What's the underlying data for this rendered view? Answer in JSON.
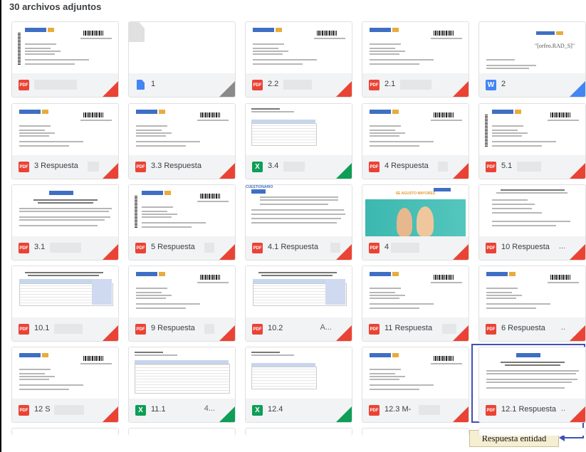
{
  "header": {
    "title": "30 archivos adjuntos"
  },
  "attachments": [
    {
      "name": "",
      "type": "pdf",
      "thumb": "letter-vertical"
    },
    {
      "name": "1",
      "type": "generic",
      "thumb": "empty"
    },
    {
      "name": "2.2",
      "type": "pdf",
      "thumb": "letter"
    },
    {
      "name": "2.1",
      "type": "pdf",
      "thumb": "letter"
    },
    {
      "name": "2",
      "type": "word",
      "thumb": "orfeo"
    },
    {
      "name": "3 Respuesta",
      "type": "pdf",
      "thumb": "letter"
    },
    {
      "name": "3.3 Respuesta",
      "type": "pdf",
      "thumb": "letter"
    },
    {
      "name": "3.4",
      "type": "excel",
      "thumb": "sheet"
    },
    {
      "name": "4 Respuesta",
      "type": "pdf",
      "thumb": "letter"
    },
    {
      "name": "5.1",
      "type": "pdf",
      "thumb": "letter-vertical"
    },
    {
      "name": "3.1",
      "type": "pdf",
      "thumb": "doc-center"
    },
    {
      "name": "5 Respuesta",
      "type": "pdf",
      "thumb": "letter-vertical"
    },
    {
      "name": "4.1 Respuesta",
      "type": "pdf",
      "thumb": "questionnaire"
    },
    {
      "name": "4",
      "type": "pdf",
      "thumb": "poster"
    },
    {
      "name": "10 Respuesta",
      "type": "pdf",
      "thumb": "form"
    },
    {
      "name": "10.1",
      "type": "pdf",
      "thumb": "table-blue"
    },
    {
      "name": "9 Respuesta",
      "type": "pdf",
      "thumb": "letter"
    },
    {
      "name": "10.2",
      "type": "pdf",
      "thumb": "table-blue"
    },
    {
      "name": "11 Respuesta",
      "type": "pdf",
      "thumb": "letter"
    },
    {
      "name": "6 Respuesta",
      "type": "pdf",
      "thumb": "letter"
    },
    {
      "name": "12 S",
      "type": "pdf",
      "thumb": "letter"
    },
    {
      "name": "11.1",
      "type": "excel",
      "thumb": "sheet-wide"
    },
    {
      "name": "12.4",
      "type": "excel",
      "thumb": "sheet"
    },
    {
      "name": "12.3 M-",
      "type": "pdf",
      "thumb": "letter"
    },
    {
      "name": "12.1 Respuesta",
      "type": "pdf",
      "thumb": "doc-center"
    }
  ],
  "truncations": {
    "10 Respuesta": "...",
    "10.2": "A...",
    "6 Respuesta": "..",
    "11.1": "4...",
    "12.1 Respuesta": ".."
  },
  "icon_labels": {
    "pdf": "PDF",
    "excel": "X",
    "word": "W"
  },
  "thumb_texts": {
    "orfeo": "\"[orfeo.RAD_S]\"",
    "questionnaire": "CUESTIONARIO",
    "poster": "SE AGUSTO MAYORES"
  },
  "annotation": {
    "label": "Respuesta entidad"
  },
  "colors": {
    "pdf": "#ea4335",
    "excel": "#0f9d58",
    "word": "#4285f4",
    "selection": "#3f51b5"
  }
}
